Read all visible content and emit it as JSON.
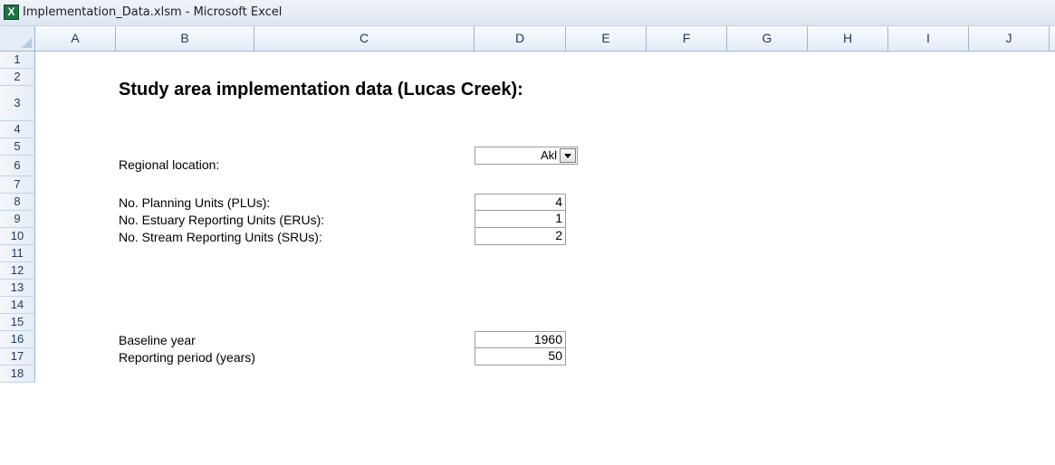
{
  "window": {
    "title": "Implementation_Data.xlsm - Microsoft Excel",
    "app_icon_glyph": "X"
  },
  "columns": [
    "A",
    "B",
    "C",
    "D",
    "E",
    "F",
    "G",
    "H",
    "I",
    "J"
  ],
  "rows": [
    "1",
    "2",
    "3",
    "4",
    "5",
    "6",
    "7",
    "8",
    "9",
    "10",
    "11",
    "12",
    "13",
    "14",
    "15",
    "16",
    "17",
    "18"
  ],
  "sheet": {
    "title": "Study area implementation data (Lucas Creek):",
    "regional_location": {
      "label": "Regional location:",
      "value": "Akl"
    },
    "planning_units": {
      "label": "No. Planning Units (PLUs):",
      "value": "4"
    },
    "estuary_units": {
      "label": "No. Estuary Reporting Units (ERUs):",
      "value": "1"
    },
    "stream_units": {
      "label": "No. Stream Reporting Units (SRUs):",
      "value": "2"
    },
    "baseline_year": {
      "label": "Baseline year",
      "value": "1960"
    },
    "reporting_period": {
      "label": "Reporting period (years)",
      "value": "50"
    }
  }
}
